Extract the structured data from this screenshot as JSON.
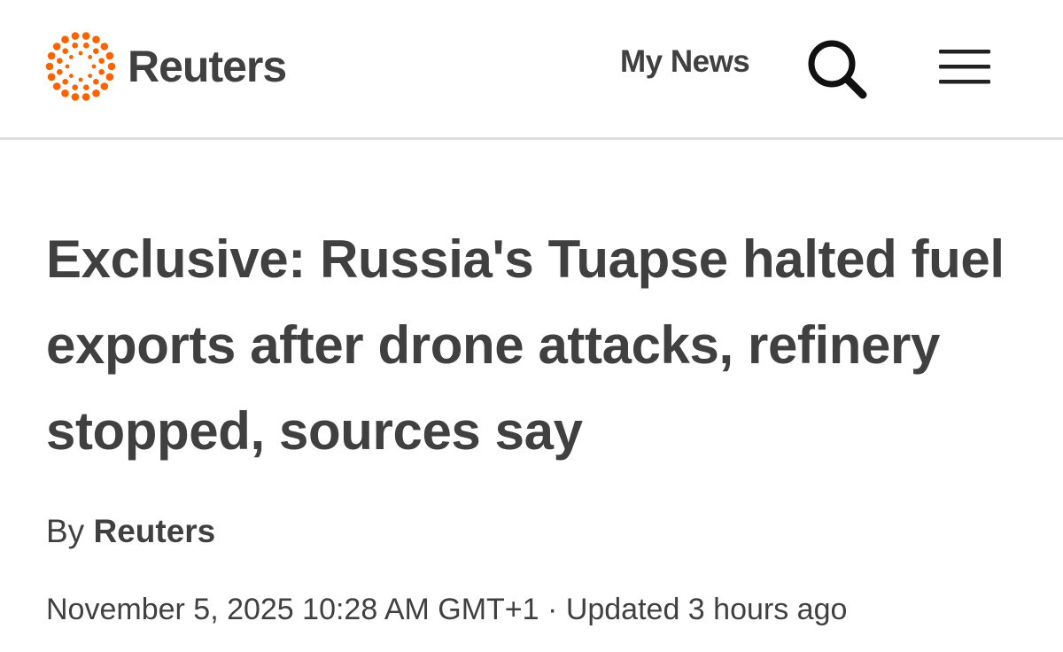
{
  "site": {
    "brand_name": "Reuters",
    "brand_color": "#fa6400",
    "text_color": "#404040"
  },
  "nav": {
    "my_news_label": "My News",
    "search_icon": "search-icon",
    "menu_icon": "hamburger-menu-icon"
  },
  "article": {
    "headline": "Exclusive: Russia's Tuapse halted fuel exports after drone attacks, refinery stopped, sources say",
    "byline_prefix": "By",
    "byline_author": "Reuters",
    "published": "November 5, 2025 10:28 AM GMT+1",
    "separator": "·",
    "updated": "Updated 3 hours ago"
  }
}
